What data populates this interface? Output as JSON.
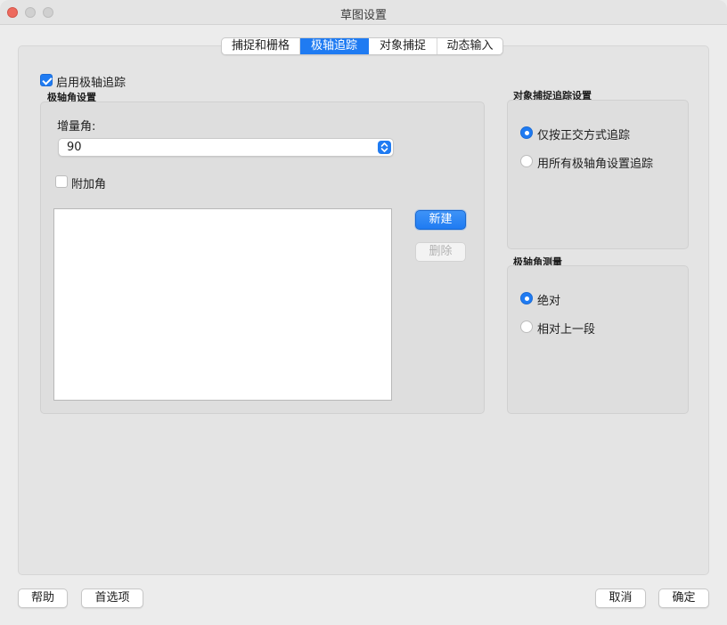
{
  "window": {
    "title": "草图设置"
  },
  "tabs": [
    {
      "label": "捕捉和栅格",
      "active": false
    },
    {
      "label": "极轴追踪",
      "active": true
    },
    {
      "label": "对象捕捉",
      "active": false
    },
    {
      "label": "动态输入",
      "active": false
    }
  ],
  "polar": {
    "enable_label": "启用极轴追踪",
    "enable_checked": true,
    "settings_title": "极轴角设置",
    "increment_label": "增量角:",
    "increment_value": "90",
    "additional_label": "附加角",
    "additional_checked": false,
    "new_button": "新建",
    "delete_button": "删除"
  },
  "object_snap_tracking": {
    "title": "对象捕捉追踪设置",
    "options": [
      {
        "label": "仅按正交方式追踪",
        "selected": true
      },
      {
        "label": "用所有极轴角设置追踪",
        "selected": false
      }
    ]
  },
  "polar_measure": {
    "title": "极轴角测量",
    "options": [
      {
        "label": "绝对",
        "selected": true
      },
      {
        "label": "相对上一段",
        "selected": false
      }
    ]
  },
  "footer": {
    "help": "帮助",
    "preferences": "首选项",
    "cancel": "取消",
    "ok": "确定"
  },
  "colors": {
    "accent": "#1f7bf2",
    "close": "#ed6a5e"
  }
}
